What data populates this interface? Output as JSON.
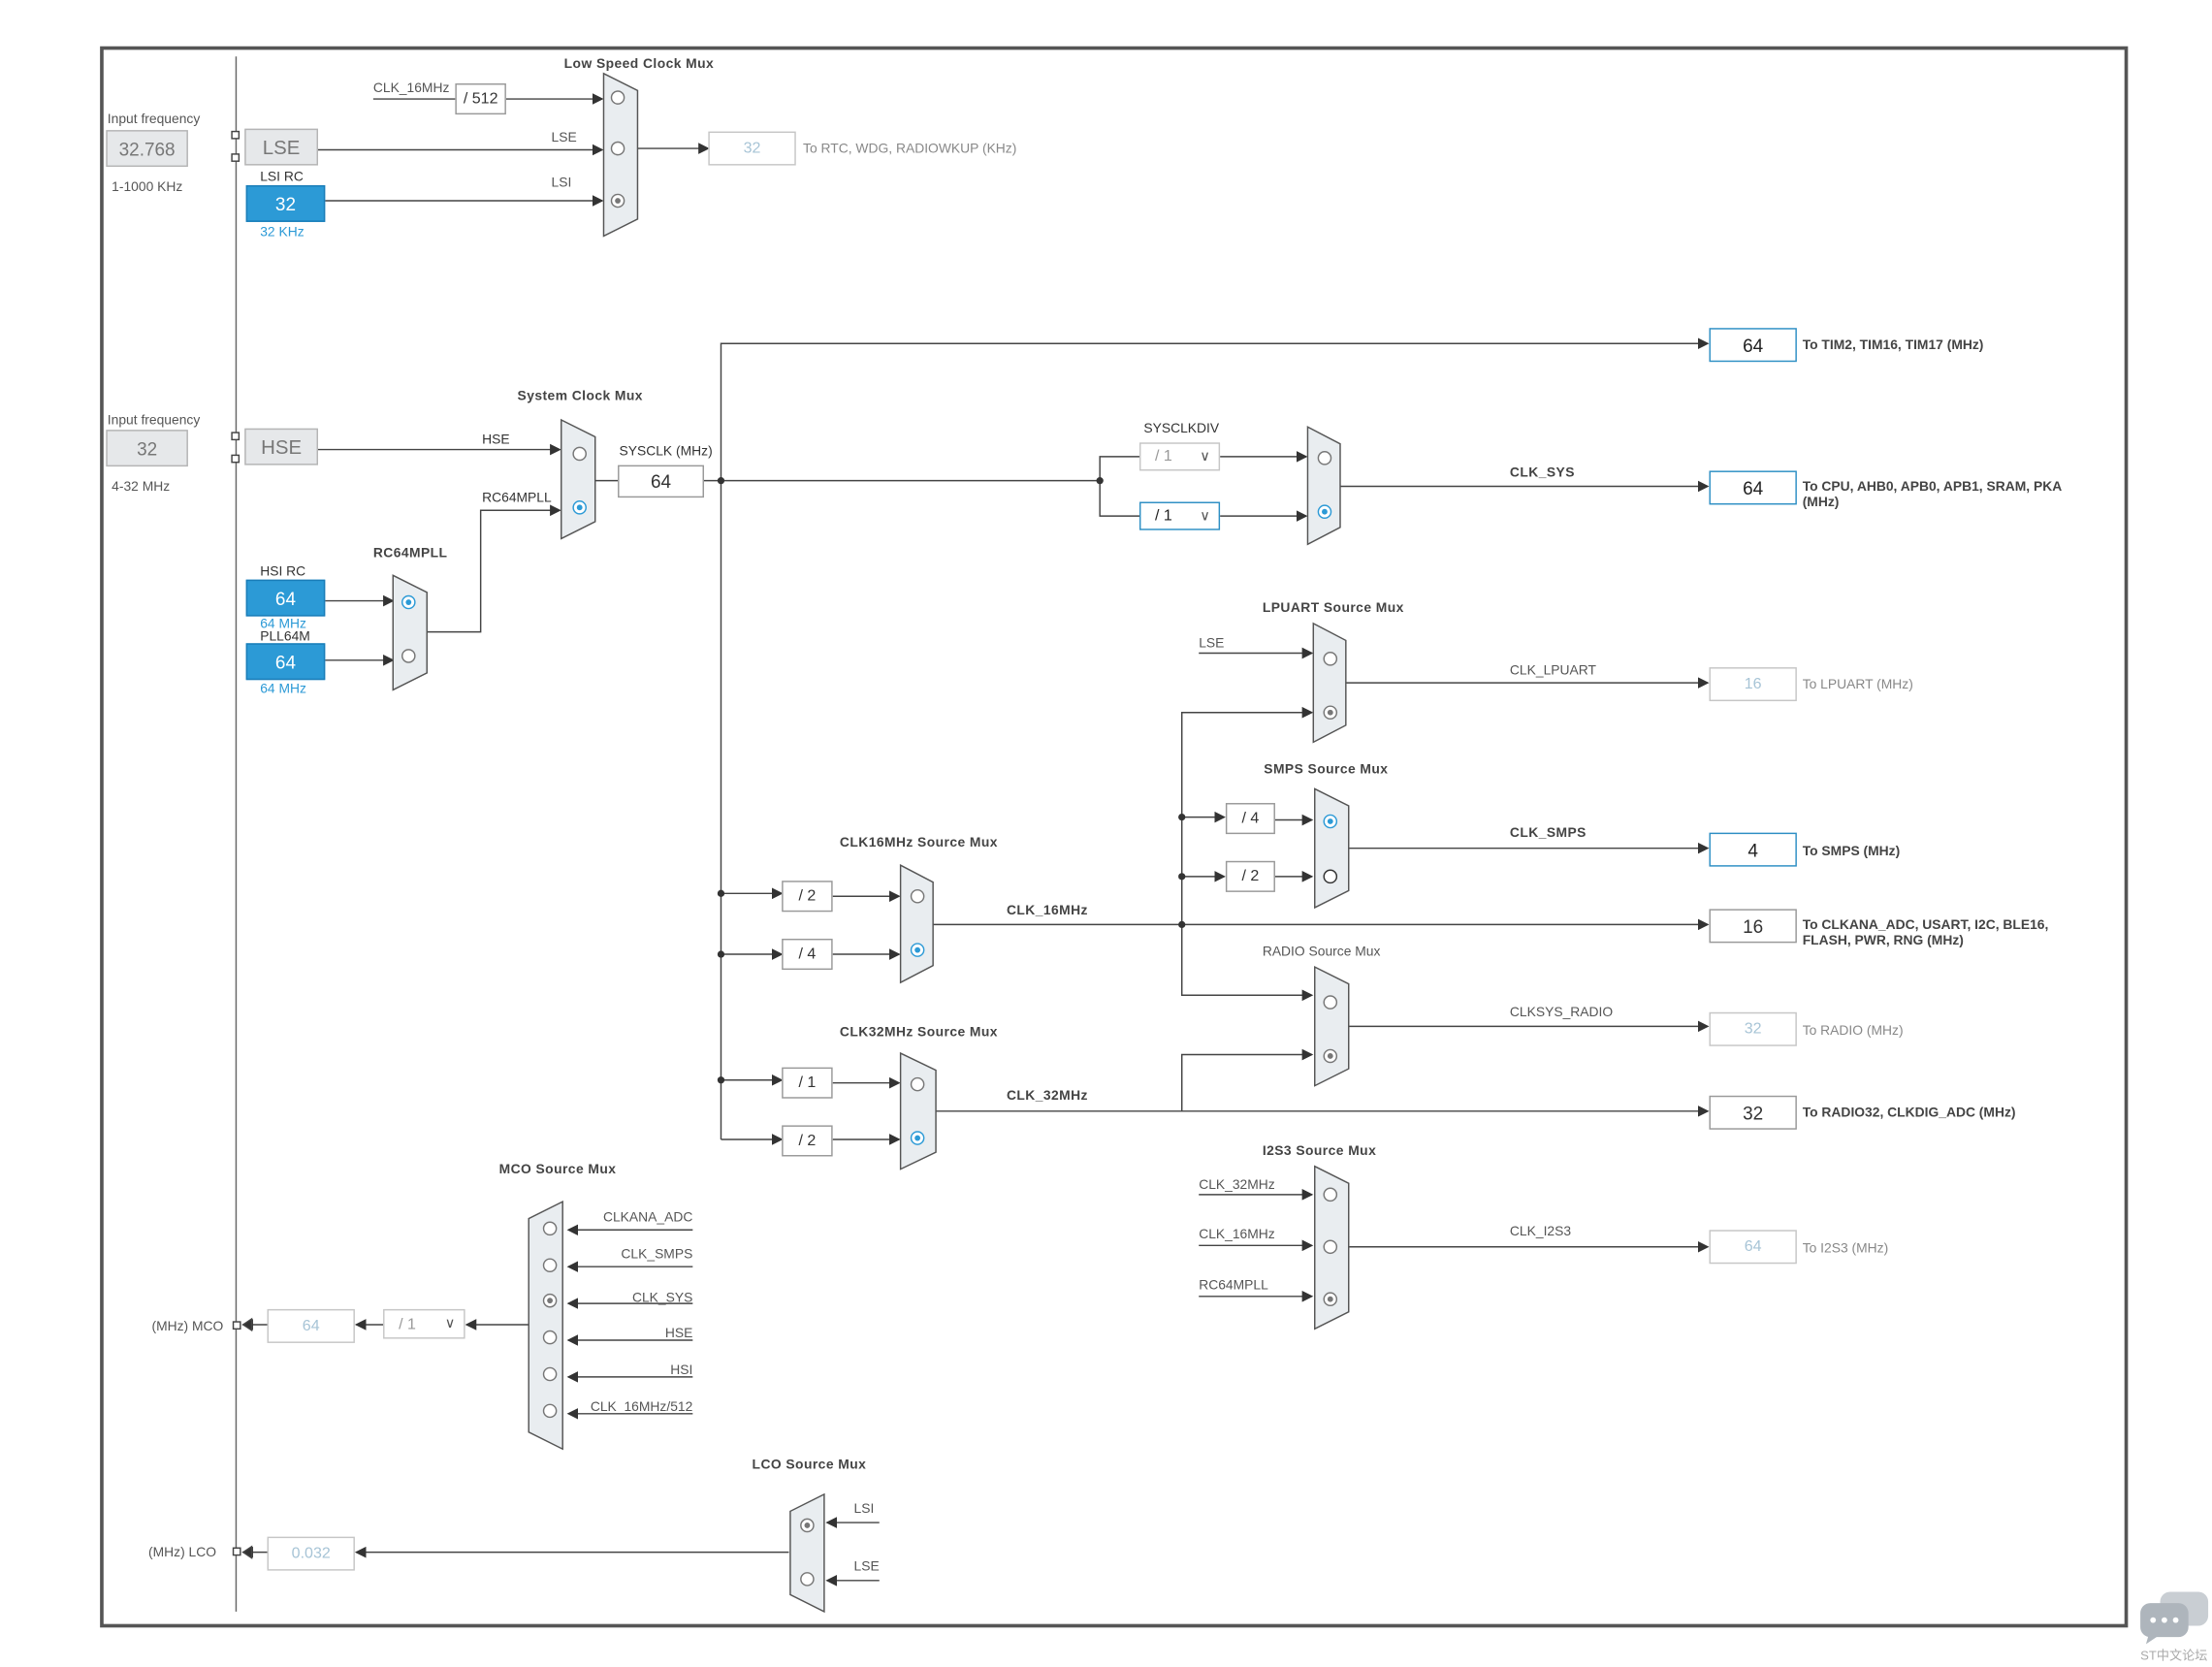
{
  "input": {
    "lse": {
      "label": "Input frequency",
      "value": "32.768",
      "range": "1-1000 KHz",
      "source": "LSE"
    },
    "lsi": {
      "title": "LSI RC",
      "value": "32",
      "unit": "32 KHz"
    },
    "hse": {
      "label": "Input frequency",
      "value": "32",
      "range": "4-32 MHz",
      "source": "HSE"
    },
    "hsi": {
      "title": "HSI RC",
      "value": "64",
      "unit": "64 MHz"
    },
    "pll64m": {
      "title": "PLL64M",
      "value": "64",
      "unit": "64 MHz"
    }
  },
  "low_speed": {
    "title": "Low Speed Clock Mux",
    "in_clk16": "CLK_16MHz",
    "div": "/ 512",
    "in_lse": "LSE",
    "in_lsi": "LSI",
    "out_value": "32",
    "out_label": "To RTC, WDG, RADIOWKUP (KHz)"
  },
  "rc64mpll": {
    "title": "RC64MPLL"
  },
  "sysclk_mux": {
    "title": "System Clock Mux",
    "in_hse": "HSE",
    "in_pll": "RC64MPLL",
    "out_label": "SYSCLK (MHz)",
    "out_value": "64"
  },
  "tim": {
    "value": "64",
    "label": "To TIM2, TIM16, TIM17 (MHz)"
  },
  "sysclkdiv": {
    "title": "SYSCLKDIV",
    "opt_a": "/ 1",
    "opt_b": "/ 1",
    "signal": "CLK_SYS",
    "value": "64",
    "label": "To CPU, AHB0, APB0, APB1, SRAM, PKA (MHz)"
  },
  "lpuart": {
    "title": "LPUART Source Mux",
    "in_lse": "LSE",
    "signal": "CLK_LPUART",
    "value": "16",
    "label": "To LPUART (MHz)"
  },
  "smps": {
    "title": "SMPS Source Mux",
    "div4": "/ 4",
    "div2": "/ 2",
    "signal": "CLK_SMPS",
    "value": "4",
    "label": "To SMPS (MHz)"
  },
  "clk16": {
    "title": "CLK16MHz Source Mux",
    "div2": "/ 2",
    "div4": "/ 4",
    "signal": "CLK_16MHz",
    "value": "16",
    "label": "To CLKANA_ADC, USART, I2C, BLE16, FLASH, PWR, RNG (MHz)"
  },
  "radio": {
    "title": "RADIO Source Mux",
    "signal": "CLKSYS_RADIO",
    "value": "32",
    "label": "To RADIO (MHz)"
  },
  "clk32": {
    "title": "CLK32MHz Source Mux",
    "div1": "/ 1",
    "div2": "/ 2",
    "signal": "CLK_32MHz",
    "value": "32",
    "label": "To RADIO32, CLKDIG_ADC (MHz)"
  },
  "i2s3": {
    "title": "I2S3 Source Mux",
    "in_a": "CLK_32MHz",
    "in_b": "CLK_16MHz",
    "in_c": "RC64MPLL",
    "signal": "CLK_I2S3",
    "value": "64",
    "label": "To I2S3 (MHz)"
  },
  "mco": {
    "title": "MCO Source Mux",
    "inputs": [
      "CLKANA_ADC",
      "CLK_SMPS",
      "CLK_SYS",
      "HSE",
      "HSI",
      "CLK_16MHz/512"
    ],
    "div": "/ 1",
    "value": "64",
    "label": "(MHz) MCO"
  },
  "lco": {
    "title": "LCO Source Mux",
    "in_lsi": "LSI",
    "in_lse": "LSE",
    "value": "0.032",
    "label": "(MHz) LCO"
  },
  "watermark": "ST中文论坛",
  "icons": {
    "chat": "chat-bubble-icon"
  }
}
